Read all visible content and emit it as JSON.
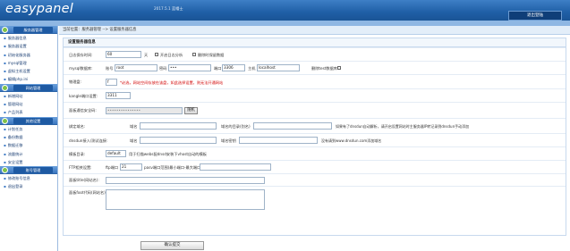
{
  "header": {
    "logo": "easypanel",
    "info": "2017.5.1  蓝帽士",
    "logout": "退出登陆"
  },
  "breadcrumb": "当前位置：服务器管理 --> 设置服务器信息",
  "sidebar": [
    {
      "title": "服务器管理",
      "items": [
        "服务器信息",
        "服务器设置",
        "初始化服务器",
        "mysql管理",
        "虚拟主机设置",
        "编辑php.ini"
      ]
    },
    {
      "title": "网站管理",
      "items": [
        "新增网站",
        "管理网站",
        "产品列表"
      ]
    },
    {
      "title": "其他设置",
      "items": [
        "计划任务",
        "备份数据",
        "数据迁移",
        "流量统计",
        "安全设置"
      ]
    },
    {
      "title": "账号管理",
      "items": [
        "修改账号信息",
        "退出登录"
      ]
    }
  ],
  "form": {
    "title": "设置服务器信息",
    "log_days": {
      "label": "日志保存时间:",
      "value": "60",
      "unit": "天",
      "opt1": "开启日志分析",
      "opt2": "删除时保留数据"
    },
    "mysql": {
      "label": "mysql数据库:",
      "user_lbl": "账号",
      "user": "root",
      "pass_lbl": "密码",
      "pass": "•••",
      "port_lbl": "端口",
      "port": "3306",
      "host_lbl": "主机",
      "host": "localhost",
      "del_lbl": "删除test数据库"
    },
    "phy": {
      "label": "物理盘:",
      "value": "f",
      "note": "*必选，网站空间存放在该盘，如此选择设置，则无法开通网站"
    },
    "ftp_port": {
      "label": "kangle端口设置:",
      "value": "3311"
    },
    "secure": {
      "label": "面板通信安全码:",
      "value": "•••••••••••••••",
      "btn": "随机"
    },
    "bind": {
      "label": "绑定域名:",
      "d1": "域名",
      "d2": "域名的目录(别名)",
      "note": "如果有了dnsdun自动解析，请开启设置网站时主服务器IP转记录到dnsdun手动添加"
    },
    "dns": {
      "label": "dnsdun接入/测试连接:",
      "d1": "域名",
      "d2": "域名密钥",
      "note": "没有请到www.dnsdun.com添加域名"
    },
    "tpl": {
      "label": "模板目录:",
      "value": "default",
      "note": "用于扫描webs配dnsd安装下vhost自动的模板"
    },
    "ftp": {
      "label": "FTP相关设置:",
      "a": "ftp端口",
      "av": "21",
      "b": "pasv端口范围(最小端口-最大端口)"
    },
    "title_field": {
      "label": "面板title(网站名):"
    },
    "footer": {
      "label": "面板foot代码(网站名):"
    },
    "submit": "确认提交"
  }
}
